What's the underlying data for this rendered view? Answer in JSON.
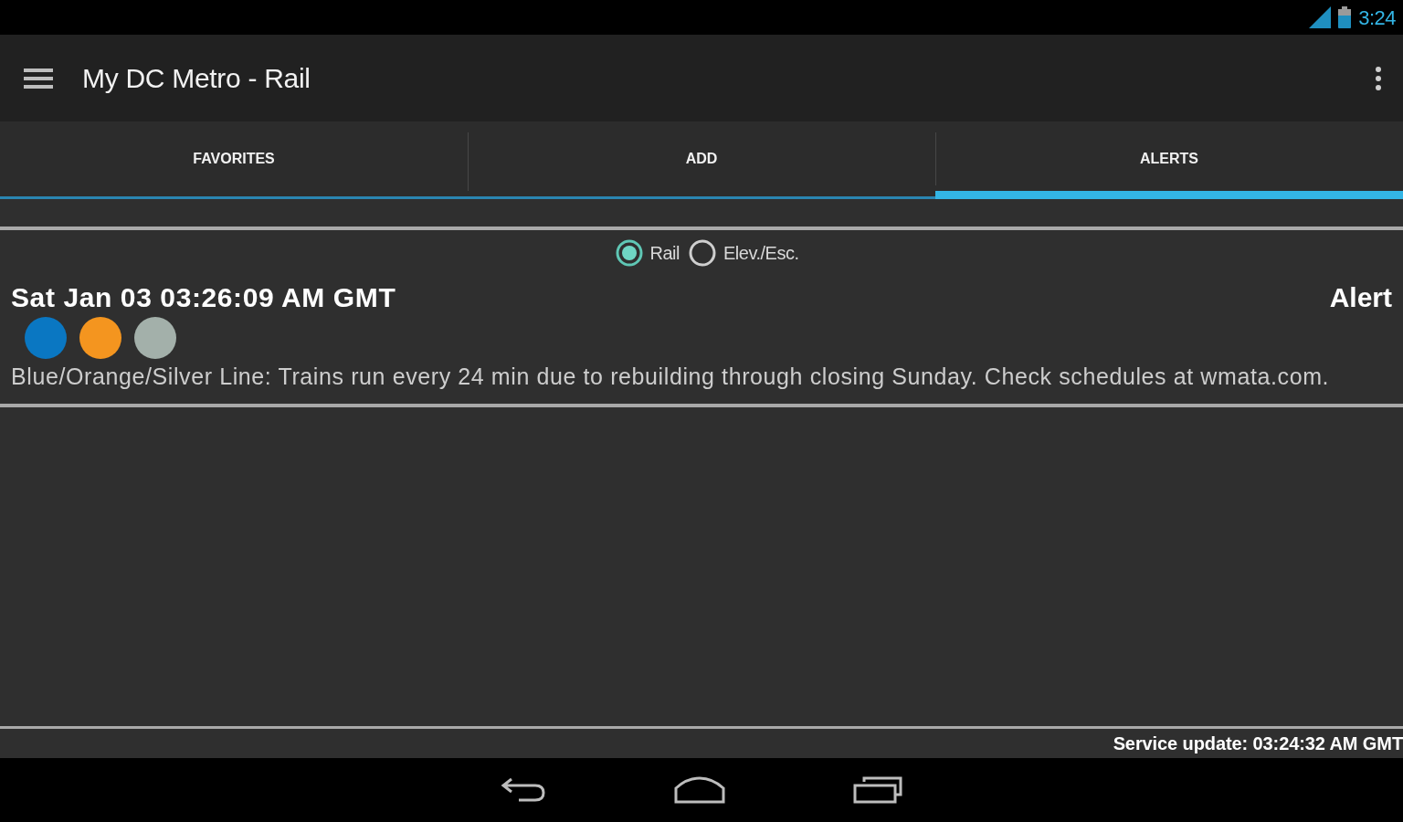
{
  "status_bar": {
    "time": "3:24"
  },
  "app_bar": {
    "title": "My DC Metro - Rail"
  },
  "tabs": [
    {
      "label": "FAVORITES",
      "selected": false
    },
    {
      "label": "ADD",
      "selected": false
    },
    {
      "label": "ALERTS",
      "selected": true
    }
  ],
  "alert_types": [
    {
      "label": "Rail",
      "selected": true
    },
    {
      "label": "Elev./Esc.",
      "selected": false
    }
  ],
  "alerts": [
    {
      "time": "Sat Jan 03 03:26:09 AM GMT",
      "heading": "Alert",
      "lines": [
        {
          "color": "#0a77c2"
        },
        {
          "color": "#f4951f"
        },
        {
          "color": "#a3b0aa"
        }
      ],
      "message": "Blue/Orange/Silver Line: Trains run every 24 min due to rebuilding through closing Sunday. Check schedules at wmata.com."
    }
  ],
  "footer": {
    "service_update": "Service update: 03:24:32 AM GMT"
  }
}
